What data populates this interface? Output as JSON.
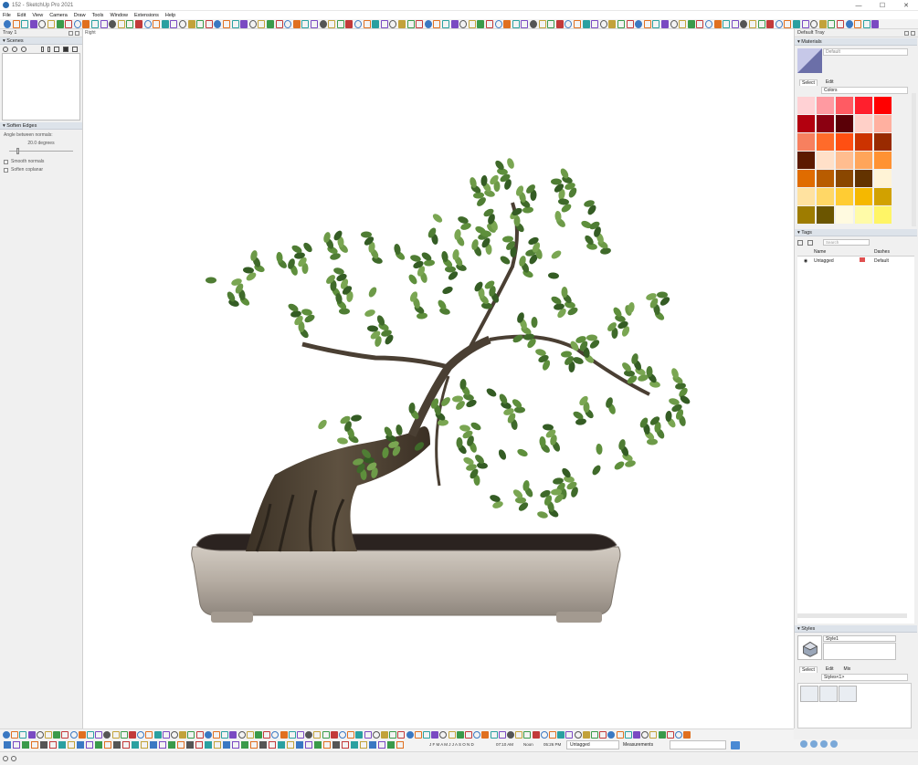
{
  "window": {
    "title": "152 - SketchUp Pro 2021",
    "minimize": "—",
    "maximize": "☐",
    "close": "✕"
  },
  "menu": [
    "File",
    "Edit",
    "View",
    "Camera",
    "Draw",
    "Tools",
    "Window",
    "Extensions",
    "Help"
  ],
  "left_tray": {
    "title": "Tray 1",
    "scenes": {
      "title": "Scenes"
    },
    "soften_edges": {
      "title": "Soften Edges",
      "angle_label": "Angle between normals:",
      "angle_value": "20.0  degrees",
      "smooth_normals": "Smooth normals",
      "soften_coplanar": "Soften coplanar"
    }
  },
  "viewport": {
    "view_label": "Right"
  },
  "right_tray": {
    "title": "Default Tray",
    "materials": {
      "title": "Materials",
      "name": "Default",
      "tab_select": "Select",
      "tab_edit": "Edit",
      "library": "Colors",
      "swatches": [
        "#ffd1d4",
        "#ff9aa1",
        "#ff5b63",
        "#ff1f2d",
        "#ff0000",
        "#b3000f",
        "#8b0011",
        "#5a0007",
        "#ffd0c8",
        "#ffb0a0",
        "#f7805f",
        "#ff6b2a",
        "#ff4f12",
        "#cc3300",
        "#992a00",
        "#5c1a00",
        "#ffe0c8",
        "#ffbd8f",
        "#ffa55a",
        "#ff9233",
        "#e06c00",
        "#b85c00",
        "#8a4700",
        "#633300",
        "#fff3d6",
        "#ffe2a0",
        "#ffd766",
        "#ffcc33",
        "#f5b800",
        "#d1a100",
        "#9e7c00",
        "#6b5500",
        "#fffae0",
        "#fffba8",
        "#fff566"
      ]
    },
    "tags": {
      "title": "Tags",
      "search_placeholder": "Search",
      "col_name": "Name",
      "col_dashes": "Dashes",
      "rows": [
        {
          "name": "Untagged",
          "color": "#e05050",
          "dashes": "Default"
        }
      ]
    },
    "styles": {
      "title": "Styles",
      "style_name": "Style1",
      "tab_select": "Select",
      "tab_edit": "Edit",
      "tab_mix": "Mix",
      "library": "Styles<1>"
    }
  },
  "status": {
    "months": "J F M A M J J A S O N D",
    "time_start": "07:10 AM",
    "noon": "Noon",
    "time_end": "05:26 PM",
    "tag_value": "Untagged",
    "measurements_label": "Measurements"
  }
}
